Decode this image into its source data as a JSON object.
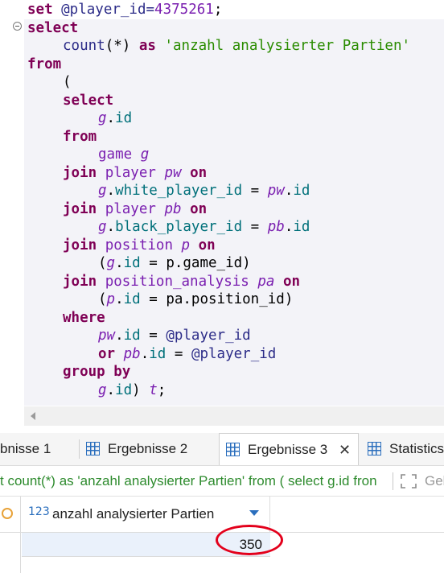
{
  "editor": {
    "lines": [
      {
        "indent": 0,
        "tokens": [
          {
            "t": "set",
            "c": "kw"
          },
          {
            "t": " @player_id=",
            "c": "var"
          },
          {
            "t": "4375261",
            "c": "num"
          },
          {
            "t": ";",
            "c": "pl"
          }
        ]
      },
      {
        "indent": 0,
        "tokens": [
          {
            "t": "select",
            "c": "kw"
          }
        ]
      },
      {
        "indent": 1,
        "tokens": [
          {
            "t": "count",
            "c": "var"
          },
          {
            "t": "(*) ",
            "c": "pl"
          },
          {
            "t": "as",
            "c": "kw"
          },
          {
            "t": " ",
            "c": "pl"
          },
          {
            "t": "'anzahl analysierter Partien'",
            "c": "str"
          }
        ]
      },
      {
        "indent": 0,
        "tokens": [
          {
            "t": "from",
            "c": "kw"
          }
        ]
      },
      {
        "indent": 1,
        "tokens": [
          {
            "t": "(",
            "c": "pl"
          }
        ]
      },
      {
        "indent": 1,
        "tokens": [
          {
            "t": "select",
            "c": "kw"
          }
        ]
      },
      {
        "indent": 2,
        "tokens": [
          {
            "t": "g",
            "c": "al"
          },
          {
            "t": ".",
            "c": "pl"
          },
          {
            "t": "id",
            "c": "col"
          }
        ]
      },
      {
        "indent": 1,
        "tokens": [
          {
            "t": "from",
            "c": "kw"
          }
        ]
      },
      {
        "indent": 2,
        "tokens": [
          {
            "t": "game",
            "c": "tbl"
          },
          {
            "t": " ",
            "c": "pl"
          },
          {
            "t": "g",
            "c": "al"
          }
        ]
      },
      {
        "indent": 1,
        "tokens": [
          {
            "t": "join",
            "c": "kw"
          },
          {
            "t": " ",
            "c": "pl"
          },
          {
            "t": "player",
            "c": "tbl"
          },
          {
            "t": " ",
            "c": "pl"
          },
          {
            "t": "pw",
            "c": "al"
          },
          {
            "t": " ",
            "c": "pl"
          },
          {
            "t": "on",
            "c": "kw"
          }
        ]
      },
      {
        "indent": 2,
        "tokens": [
          {
            "t": "g",
            "c": "al"
          },
          {
            "t": ".",
            "c": "pl"
          },
          {
            "t": "white_player_id",
            "c": "col"
          },
          {
            "t": " = ",
            "c": "pl"
          },
          {
            "t": "pw",
            "c": "al"
          },
          {
            "t": ".",
            "c": "pl"
          },
          {
            "t": "id",
            "c": "col"
          }
        ]
      },
      {
        "indent": 1,
        "tokens": [
          {
            "t": "join",
            "c": "kw"
          },
          {
            "t": " ",
            "c": "pl"
          },
          {
            "t": "player",
            "c": "tbl"
          },
          {
            "t": " ",
            "c": "pl"
          },
          {
            "t": "pb",
            "c": "al"
          },
          {
            "t": " ",
            "c": "pl"
          },
          {
            "t": "on",
            "c": "kw"
          }
        ]
      },
      {
        "indent": 2,
        "tokens": [
          {
            "t": "g",
            "c": "al"
          },
          {
            "t": ".",
            "c": "pl"
          },
          {
            "t": "black_player_id",
            "c": "col"
          },
          {
            "t": " = ",
            "c": "pl"
          },
          {
            "t": "pb",
            "c": "al"
          },
          {
            "t": ".",
            "c": "pl"
          },
          {
            "t": "id",
            "c": "col"
          }
        ]
      },
      {
        "indent": 1,
        "tokens": [
          {
            "t": "join",
            "c": "kw"
          },
          {
            "t": " ",
            "c": "pl"
          },
          {
            "t": "position",
            "c": "tbl"
          },
          {
            "t": " ",
            "c": "pl"
          },
          {
            "t": "p",
            "c": "al"
          },
          {
            "t": " ",
            "c": "pl"
          },
          {
            "t": "on",
            "c": "kw"
          }
        ]
      },
      {
        "indent": 2,
        "tokens": [
          {
            "t": "(",
            "c": "pl"
          },
          {
            "t": "g",
            "c": "al"
          },
          {
            "t": ".",
            "c": "pl"
          },
          {
            "t": "id",
            "c": "col"
          },
          {
            "t": " = p.game_id)",
            "c": "pl"
          }
        ]
      },
      {
        "indent": 1,
        "tokens": [
          {
            "t": "join",
            "c": "kw"
          },
          {
            "t": " ",
            "c": "pl"
          },
          {
            "t": "position_analysis",
            "c": "tbl"
          },
          {
            "t": " ",
            "c": "pl"
          },
          {
            "t": "pa",
            "c": "al"
          },
          {
            "t": " ",
            "c": "pl"
          },
          {
            "t": "on",
            "c": "kw"
          }
        ]
      },
      {
        "indent": 2,
        "tokens": [
          {
            "t": "(",
            "c": "pl"
          },
          {
            "t": "p",
            "c": "al"
          },
          {
            "t": ".",
            "c": "pl"
          },
          {
            "t": "id",
            "c": "col"
          },
          {
            "t": " = pa.position_id)",
            "c": "pl"
          }
        ]
      },
      {
        "indent": 1,
        "tokens": [
          {
            "t": "where",
            "c": "kw"
          }
        ]
      },
      {
        "indent": 2,
        "tokens": [
          {
            "t": "pw",
            "c": "al"
          },
          {
            "t": ".",
            "c": "pl"
          },
          {
            "t": "id",
            "c": "col"
          },
          {
            "t": " = ",
            "c": "pl"
          },
          {
            "t": "@player_id",
            "c": "var"
          }
        ]
      },
      {
        "indent": 2,
        "tokens": [
          {
            "t": "or",
            "c": "kw"
          },
          {
            "t": " ",
            "c": "pl"
          },
          {
            "t": "pb",
            "c": "al"
          },
          {
            "t": ".",
            "c": "pl"
          },
          {
            "t": "id",
            "c": "col"
          },
          {
            "t": " = ",
            "c": "pl"
          },
          {
            "t": "@player_id",
            "c": "var"
          }
        ]
      },
      {
        "indent": 1,
        "tokens": [
          {
            "t": "group by",
            "c": "kw"
          }
        ]
      },
      {
        "indent": 2,
        "tokens": [
          {
            "t": "g",
            "c": "al"
          },
          {
            "t": ".",
            "c": "pl"
          },
          {
            "t": "id",
            "c": "col"
          },
          {
            "t": ") ",
            "c": "pl"
          },
          {
            "t": "t",
            "c": "al"
          },
          {
            "t": ";",
            "c": "pl"
          }
        ]
      }
    ]
  },
  "tabs": {
    "tab1_label": "bnisse 1",
    "tab2_label": "Ergebnisse 2",
    "tab3_label": "Ergebnisse 3",
    "tab4_label": "Statistics",
    "close_glyph": "✕"
  },
  "query": {
    "text": "t count(*) as 'anzahl analysierter Partien' from ( select g.id fron",
    "next_label": "Gel"
  },
  "result": {
    "column_type_icon": "123",
    "column_title": "anzahl analysierter Partien",
    "value": "350"
  },
  "colors": {
    "keyword": "#7f0055",
    "string": "#2a8c00",
    "highlight_circle": "#e3001b",
    "icon_blue": "#2a6ebd"
  }
}
